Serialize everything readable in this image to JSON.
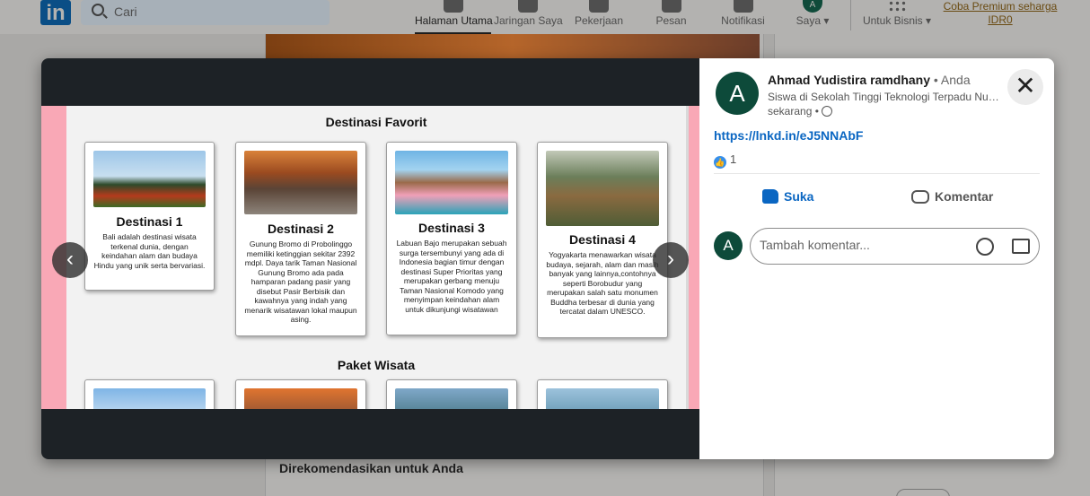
{
  "nav": {
    "logo": "in",
    "search_placeholder": "Cari",
    "items": [
      {
        "label": "Halaman Utama"
      },
      {
        "label": "Jaringan Saya"
      },
      {
        "label": "Pekerjaan"
      },
      {
        "label": "Pesan"
      },
      {
        "label": "Notifikasi"
      },
      {
        "label": "Saya ▾",
        "avatar": "A"
      },
      {
        "label": "Untuk Bisnis ▾"
      }
    ],
    "premium_line1": "Coba Premium seharga",
    "premium_line2": "IDR0"
  },
  "feed": {
    "recommended_title": "Direkomendasikan untuk Anda"
  },
  "post_image": {
    "section1_title": "Destinasi Favorit",
    "section2_title": "Paket Wisata",
    "cards": [
      {
        "title": "Destinasi 1",
        "desc": "Bali adalah destinasi wisata terkenal dunia, dengan keindahan alam dan budaya Hindu yang unik serta bervariasi."
      },
      {
        "title": "Destinasi 2",
        "desc": "Gunung Bromo di Probolinggo memiliki ketinggian sekitar 2392 mdpl. Daya tarik Taman Nasional Gunung Bromo ada pada hamparan padang pasir yang disebut Pasir Berbisik dan kawahnya yang indah yang menarik wisatawan lokal maupun asing."
      },
      {
        "title": "Destinasi 3",
        "desc": "Labuan Bajo merupakan sebuah surga tersembunyi yang ada di Indonesia bagian timur dengan destinasi Super Prioritas yang merupakan gerbang menuju Taman Nasional Komodo yang menyimpan keindahan alam untuk dikunjungi wisatawan"
      },
      {
        "title": "Destinasi 4",
        "desc": "Yogyakarta menawarkan wisata budaya, sejarah, alam dan masih banyak yang lainnya,contohnya seperti Borobudur yang merupakan salah satu monumen Buddha terbesar di dunia yang tercatat dalam UNESCO."
      }
    ],
    "prev_icon": "‹",
    "next_icon": "›"
  },
  "post": {
    "avatar_letter": "A",
    "author": "Ahmad Yudistira ramdhany",
    "author_suffix": " • Anda",
    "headline": "Siswa di Sekolah Tinggi Teknologi Terpadu Nurul Fikri",
    "time": "sekarang •",
    "link": "https://lnkd.in/eJ5NNAbF",
    "reaction_count": "1",
    "like_label": "Suka",
    "comment_label": "Komentar",
    "comment_placeholder": "Tambah komentar...",
    "close_icon": "✕"
  },
  "colors": {
    "brand": "#0a66c2",
    "avatar_bg": "#0d4a3a",
    "viewer_bg": "#1d2226"
  }
}
